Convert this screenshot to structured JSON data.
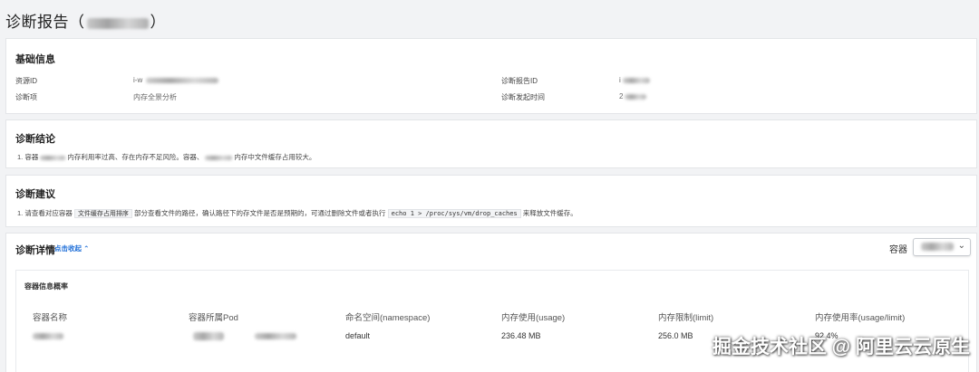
{
  "page": {
    "title_prefix": "诊断报告（",
    "title_suffix": "）"
  },
  "basic_info": {
    "title": "基础信息",
    "fields": [
      {
        "label": "资源ID",
        "value": "i-w"
      },
      {
        "label": "诊断报告ID",
        "value": "i"
      },
      {
        "label": "诊断项",
        "value": "内存全景分析"
      },
      {
        "label": "诊断发起时间",
        "value": "2"
      }
    ]
  },
  "conclusion": {
    "title": "诊断结论",
    "line_a": "1. 容器",
    "line_b": "内存利用率过高、存在内存不足风险。容器、",
    "line_c": "内存中文件缓存占用较大。"
  },
  "advice": {
    "title": "诊断建议",
    "seg1": "1. 请查看对应容器",
    "code1": "文件缓存占用排序",
    "seg2": "部分查看文件的路径，确认路径下的存文件是否是预期的，可通过删除文件或者执行",
    "code2": "echo 1 > /proc/sys/vm/drop_caches",
    "seg3": "来释放文件缓存。"
  },
  "detail": {
    "title": "诊断详情",
    "toggle_label": "点击收起",
    "toggle_icon": "chevron-up-icon",
    "container_label": "容器",
    "select_icon": "chevron-down-icon",
    "table_title": "容器信息概率",
    "columns": [
      "容器名称",
      "容器所属Pod",
      "命名空间(namespace)",
      "内存使用(usage)",
      "内存限制(limit)",
      "内存使用率(usage/limit)"
    ],
    "row": {
      "namespace": "default",
      "usage": "236.48 MB",
      "limit": "256.0 MB",
      "rate": "92.4%"
    }
  },
  "watermark": "掘金技术社区 @ 阿里云云原生",
  "colors": {
    "accent": "#1f6fd8",
    "background": "#f2f3f5",
    "card": "#ffffff"
  }
}
